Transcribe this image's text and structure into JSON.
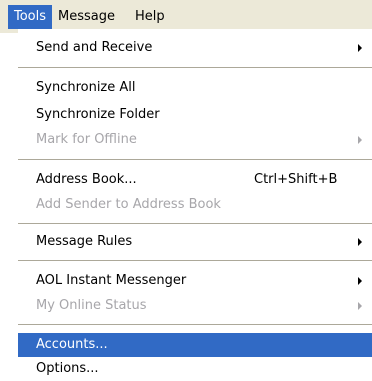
{
  "menubar": {
    "items": [
      {
        "label": "Tools"
      },
      {
        "label": "Message"
      },
      {
        "label": "Help"
      }
    ]
  },
  "tools_menu": {
    "items": [
      {
        "label": "Send and Receive",
        "submenu": true
      },
      {
        "label": "Synchronize All"
      },
      {
        "label": "Synchronize Folder"
      },
      {
        "label": "Mark for Offline",
        "disabled": true,
        "submenu": true
      },
      {
        "label": "Address Book...",
        "shortcut": "Ctrl+Shift+B"
      },
      {
        "label": "Add Sender to Address Book",
        "disabled": true
      },
      {
        "label": "Message Rules",
        "submenu": true
      },
      {
        "label": "AOL Instant Messenger",
        "submenu": true
      },
      {
        "label": "My Online Status",
        "disabled": true,
        "submenu": true
      },
      {
        "label": "Accounts...",
        "highlighted": true
      },
      {
        "label": "Options..."
      }
    ]
  },
  "colors": {
    "highlight": "#316ac5",
    "highlight_text": "#ffffff",
    "disabled_text": "#a7a6aa",
    "menubar_bg": "#ece9d8",
    "separator": "#aca899"
  }
}
